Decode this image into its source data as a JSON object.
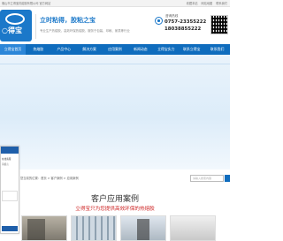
{
  "topbar": {
    "left_text": "佛山市立得宝热熔胶有限公司 官方网站",
    "links": [
      "收藏本站",
      "网站地图",
      "联系我们"
    ]
  },
  "header": {
    "logo_text": "○得宝",
    "slogan": "立时粘得，胶粘之宝",
    "subslogan": "专业生产热熔胶、高效环保热熔胶，服务于包装、印刷、家具等行业",
    "phone_label": "咨询热线",
    "phone1": "0757-23355222",
    "phone2": "18038855222"
  },
  "nav": {
    "items": [
      {
        "label": "立得宝首页",
        "active": true
      },
      {
        "label": "热熔胶",
        "active": false
      },
      {
        "label": "产品中心",
        "active": false
      },
      {
        "label": "解决方案",
        "active": false
      },
      {
        "label": "应用案例",
        "active": false
      },
      {
        "label": "新闻动态",
        "active": false
      },
      {
        "label": "立得宝实力",
        "active": false
      },
      {
        "label": "联系立得宝",
        "active": false
      },
      {
        "label": "联系我们",
        "active": false
      }
    ]
  },
  "chat": {
    "line1": "在线客服",
    "line2": "请留言"
  },
  "breadcrumb": {
    "text": "您当前的位置：首页 > 客户案例 > 应用案例",
    "search_placeholder": "请输入搜索内容"
  },
  "section": {
    "title": "客户应用案例",
    "subtitle": "立得宝只为您提供高效环保的热熔胶"
  },
  "colors": {
    "brand_blue": "#1b78c9",
    "nav_blue": "#0f6cbd",
    "subtitle_red": "#cc1e1e"
  }
}
